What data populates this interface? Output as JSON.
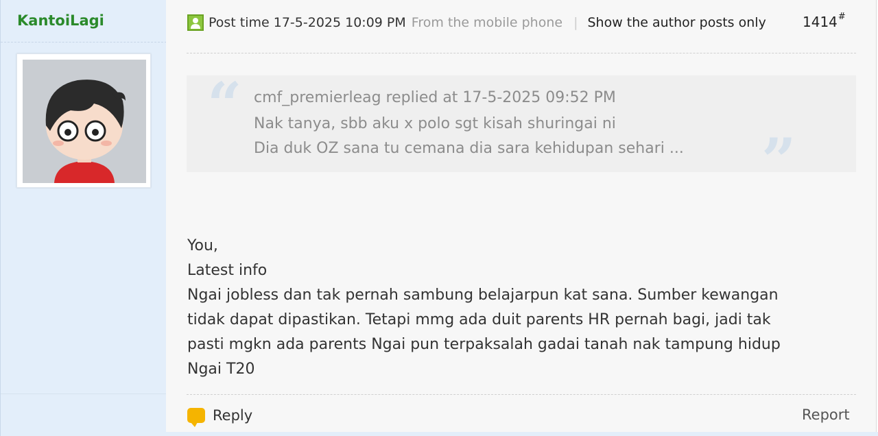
{
  "author": {
    "username": "KantoiLagi",
    "avatar_icon": "cartoon-boy-avatar"
  },
  "post": {
    "post_time": "Post time 17-5-2025 10:09 PM",
    "from_mobile": "From the mobile phone",
    "separator": "|",
    "show_author_only": "Show the author posts only",
    "floor_number": "1414",
    "floor_suffix": "#"
  },
  "quote": {
    "header": "cmf_premierleag replied at 17-5-2025 09:52 PM",
    "lines": [
      "Nak tanya, sbb aku x polo sgt kisah shuringai ni",
      "Dia duk OZ sana tu cemana dia sara kehidupan sehari ..."
    ],
    "open_mark": "“",
    "close_mark": "”"
  },
  "body": {
    "lines": [
      "You,",
      "Latest info",
      "Ngai jobless dan tak pernah sambung belajarpun kat sana. Sumber kewangan",
      "tidak dapat dipastikan. Tetapi mmg ada duit parents HR pernah bagi, jadi tak",
      "pasti mgkn ada parents Ngai pun terpaksalah gadai tanah nak tampung hidup",
      "Ngai T20"
    ]
  },
  "actions": {
    "reply_label": "Reply",
    "report_label": "Report"
  },
  "colors": {
    "username": "#2b8a2b",
    "sidebar_bg": "#e3eefa",
    "main_bg": "#f7f7f7",
    "quote_bg": "#efefef",
    "reply_icon": "#f5b400"
  }
}
